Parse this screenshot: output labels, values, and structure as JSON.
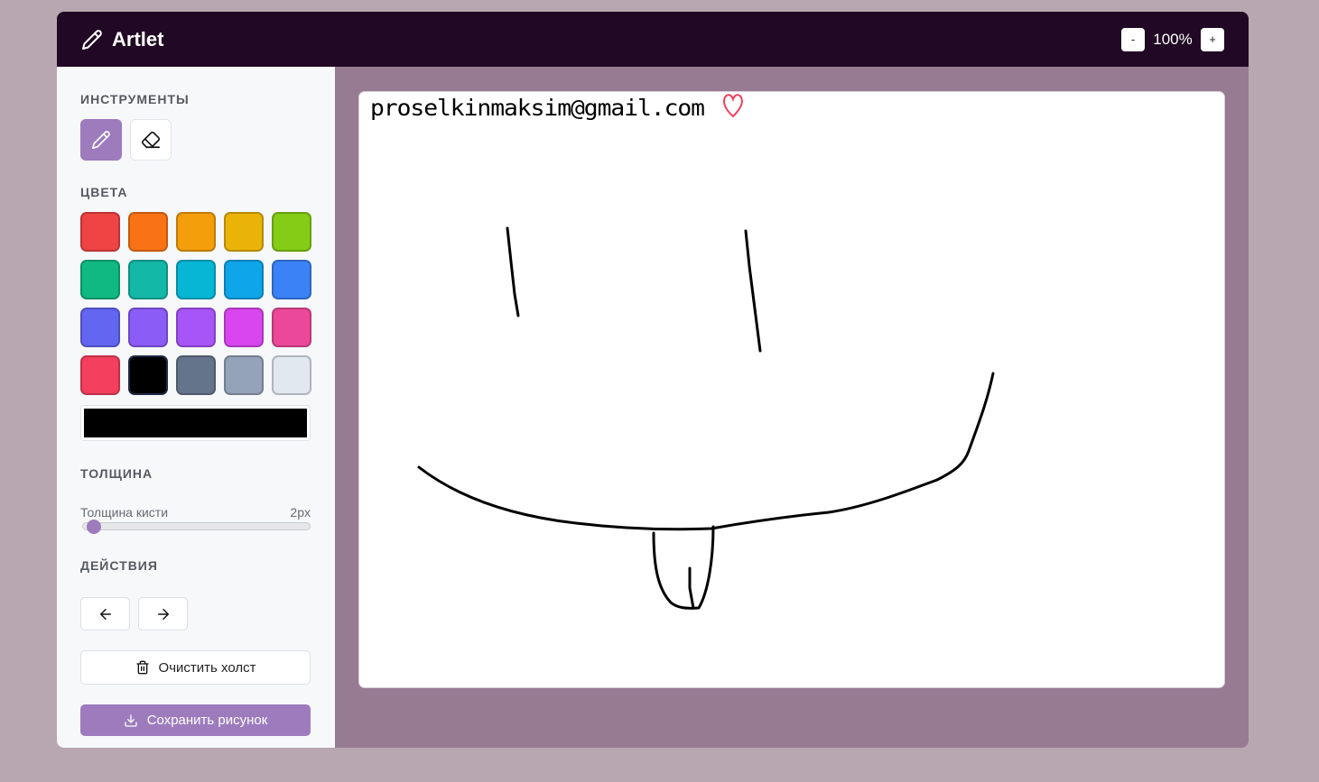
{
  "app": {
    "title": "Artlet"
  },
  "zoom": {
    "minus_label": "-",
    "value": "100%",
    "plus_label": "+"
  },
  "sidebar": {
    "tools_title": "ИНСТРУМЕНТЫ",
    "tools": [
      {
        "name": "pencil",
        "icon": "pencil-icon",
        "active": true
      },
      {
        "name": "eraser",
        "icon": "eraser-icon",
        "active": false
      }
    ],
    "colors_title": "ЦВЕТА",
    "colors": [
      "#ef4444",
      "#f97316",
      "#f59e0b",
      "#eab308",
      "#84cc16",
      "#10b981",
      "#14b8a6",
      "#06b6d4",
      "#0ea5e9",
      "#3b82f6",
      "#6366f1",
      "#8b5cf6",
      "#a855f7",
      "#d946ef",
      "#ec4899",
      "#f43f5e",
      "#000000",
      "#64748b",
      "#94a3b8",
      "#e2e8f0"
    ],
    "selected_color": "#000000",
    "thickness_title": "ТОЛЩИНА",
    "thickness_label": "Толщина кисти",
    "thickness_value": "2px",
    "thickness_level": 0.02,
    "actions_title": "ДЕЙСТВИЯ",
    "undo_icon": "arrow-left-icon",
    "redo_icon": "arrow-right-icon",
    "clear_label": "Очистить холст",
    "clear_icon": "trash-icon",
    "save_label": "Сохранить рисунок",
    "save_icon": "download-icon"
  },
  "canvas": {
    "handwritten_text": "proselkinmaksim@gmail.com",
    "heart_color": "#f03e5e",
    "stroke_color": "#000000"
  },
  "colors": {
    "header_bg": "#210824",
    "accent": "#9d7bbd",
    "workspace_bg": "#977b93",
    "page_bg": "#b8a7b0"
  }
}
